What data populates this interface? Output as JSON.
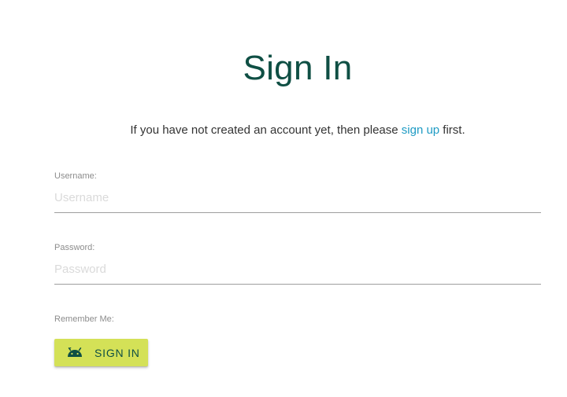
{
  "page": {
    "title": "Sign In",
    "intro": {
      "before_link": "If you have not created an account yet, then please ",
      "link_text": "sign up",
      "after_link": " first."
    }
  },
  "form": {
    "username": {
      "label": "Username:",
      "placeholder": "Username",
      "value": ""
    },
    "password": {
      "label": "Password:",
      "placeholder": "Password",
      "value": ""
    },
    "remember_label": "Remember Me:",
    "submit": {
      "label": "SIGN IN",
      "icon": "android-icon"
    }
  },
  "colors": {
    "title": "#0f4f44",
    "link": "#1e9bc4",
    "button_bg": "#d4e157",
    "button_text": "#0f4f44"
  }
}
